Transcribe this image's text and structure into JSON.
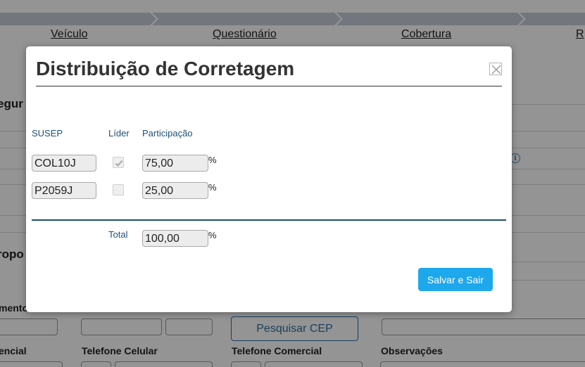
{
  "background": {
    "steps": [
      "Veículo",
      "Questionário",
      "Cobertura",
      "R"
    ],
    "headings": [
      "egur",
      "ropo"
    ],
    "labels": {
      "mento": "mento",
      "encial": "encial",
      "telefone_celular": "Telefone Celular",
      "telefone_comercial": "Telefone Comercial",
      "observacoes": "Observações"
    },
    "search_cep_label": "Pesquisar CEP",
    "info_icon": "i"
  },
  "modal": {
    "title": "Distribuição de Corretagem",
    "columns": {
      "susep": "SUSEP",
      "lider": "Líder",
      "participacao": "Participação"
    },
    "rows": [
      {
        "susep": "COL10J",
        "lider": true,
        "participacao": "75,00"
      },
      {
        "susep": "P2059J",
        "lider": false,
        "participacao": "25,00"
      }
    ],
    "percent_sign": "%",
    "total_label": "Total",
    "total_value": "100,00",
    "save_button": "Salvar e Sair"
  },
  "icons": {
    "close": "close-icon",
    "check": "check-icon",
    "info": "info-icon"
  },
  "colors": {
    "overlay": "rgba(0,0,0,0.42)",
    "accent_button": "#1ea8ec",
    "header_text": "#1f4f78",
    "section_rule": "#1e4e66"
  }
}
